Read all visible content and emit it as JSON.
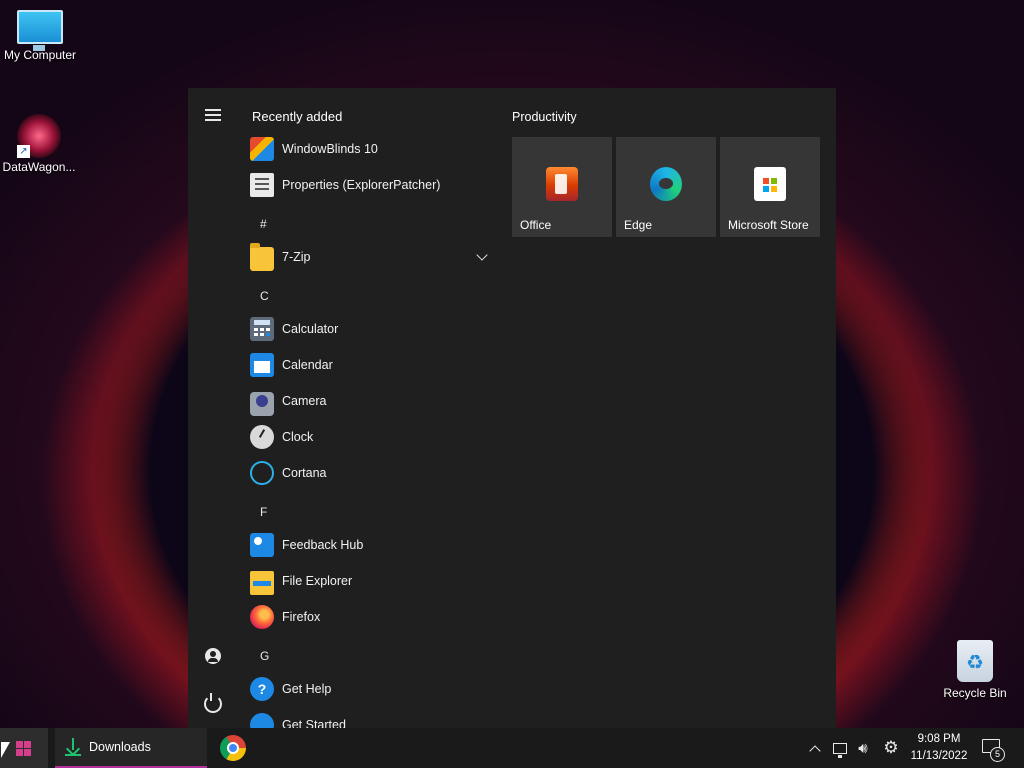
{
  "desktop": {
    "icons": [
      {
        "label": "My Computer"
      },
      {
        "label": "DataWagon..."
      },
      {
        "label": "Recycle Bin"
      }
    ]
  },
  "start_menu": {
    "recently_added_header": "Recently added",
    "recently_added": [
      {
        "label": "WindowBlinds 10",
        "icon": "windowblinds-icon"
      },
      {
        "label": "Properties (ExplorerPatcher)",
        "icon": "properties-icon"
      }
    ],
    "groups": [
      {
        "letter": "#",
        "apps": [
          {
            "label": "7-Zip",
            "icon": "folder-icon",
            "expandable": true
          }
        ]
      },
      {
        "letter": "C",
        "apps": [
          {
            "label": "Calculator",
            "icon": "calculator-icon"
          },
          {
            "label": "Calendar",
            "icon": "calendar-icon"
          },
          {
            "label": "Camera",
            "icon": "camera-icon"
          },
          {
            "label": "Clock",
            "icon": "clock-icon"
          },
          {
            "label": "Cortana",
            "icon": "cortana-icon"
          }
        ]
      },
      {
        "letter": "F",
        "apps": [
          {
            "label": "Feedback Hub",
            "icon": "feedback-hub-icon"
          },
          {
            "label": "File Explorer",
            "icon": "file-explorer-icon"
          },
          {
            "label": "Firefox",
            "icon": "firefox-icon"
          }
        ]
      },
      {
        "letter": "G",
        "apps": [
          {
            "label": "Get Help",
            "icon": "get-help-icon"
          },
          {
            "label": "Get Started",
            "icon": "get-started-icon"
          }
        ]
      }
    ],
    "tiles_header": "Productivity",
    "tiles": [
      {
        "label": "Office",
        "icon": "office-icon"
      },
      {
        "label": "Edge",
        "icon": "edge-icon"
      },
      {
        "label": "Microsoft Store",
        "icon": "microsoft-store-icon"
      }
    ]
  },
  "taskbar": {
    "downloads_label": "Downloads",
    "clock_time": "9:08 PM",
    "clock_date": "11/13/2022",
    "notification_count": "5"
  }
}
